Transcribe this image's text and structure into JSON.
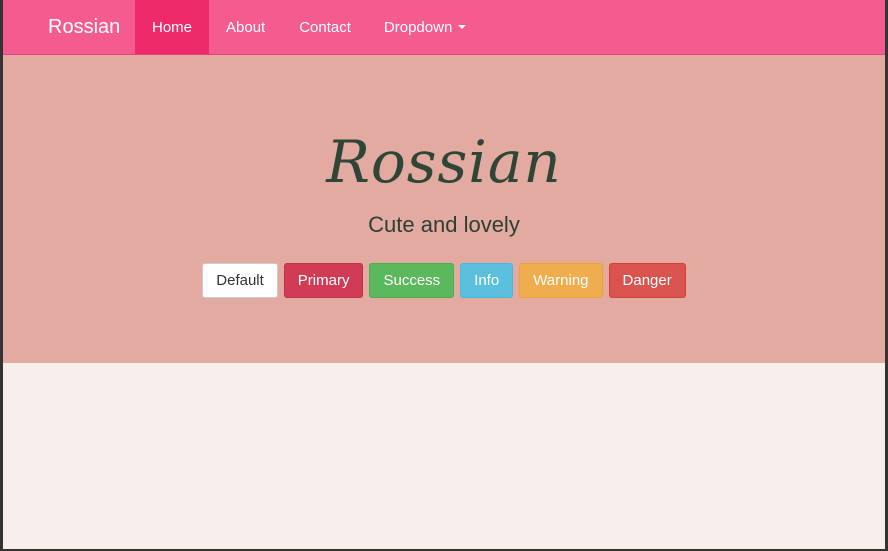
{
  "navbar": {
    "brand": "Rossian",
    "items": [
      {
        "label": "Home",
        "active": true
      },
      {
        "label": "About",
        "active": false
      },
      {
        "label": "Contact",
        "active": false
      },
      {
        "label": "Dropdown",
        "active": false
      }
    ]
  },
  "jumbotron": {
    "title": "Rossian",
    "subtitle": "Cute and lovely"
  },
  "buttons": {
    "default": "Default",
    "primary": "Primary",
    "success": "Success",
    "info": "Info",
    "warning": "Warning",
    "danger": "Danger"
  },
  "colors": {
    "navbar": "#f45b8f",
    "nav_active": "#ee2a6a",
    "jumbotron": "#e2aaa1",
    "page_background": "#f8eeec",
    "title_text": "#2f4535"
  }
}
